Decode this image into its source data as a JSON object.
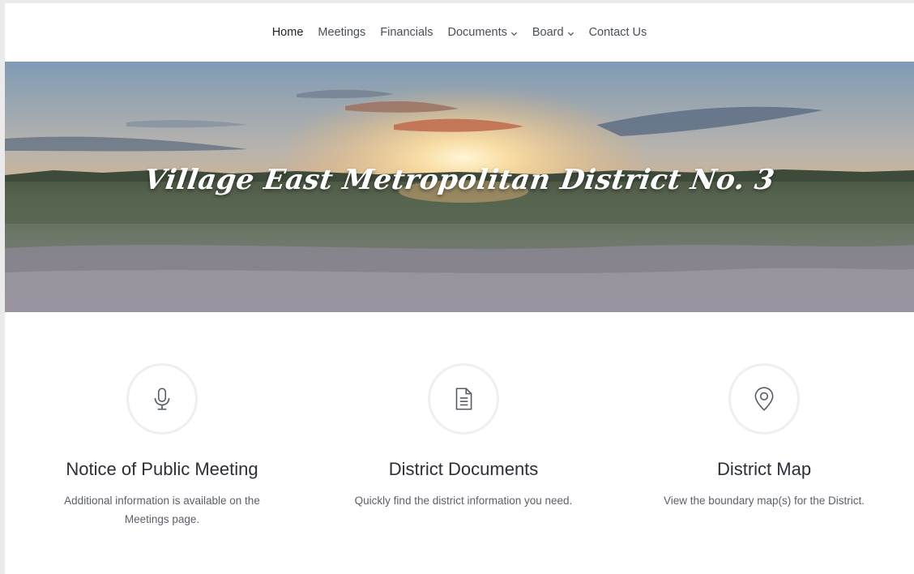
{
  "nav": {
    "items": [
      {
        "label": "Home",
        "active": true,
        "dropdown": false
      },
      {
        "label": "Meetings",
        "active": false,
        "dropdown": false
      },
      {
        "label": "Financials",
        "active": false,
        "dropdown": false
      },
      {
        "label": "Documents",
        "active": false,
        "dropdown": true
      },
      {
        "label": "Board",
        "active": false,
        "dropdown": true
      },
      {
        "label": "Contact Us",
        "active": false,
        "dropdown": false
      }
    ]
  },
  "hero": {
    "title": "Village East Metropolitan District No. 3"
  },
  "features": [
    {
      "icon": "microphone-icon",
      "title": "Notice of Public Meeting",
      "text": "Additional information is available on the Meetings page."
    },
    {
      "icon": "document-icon",
      "title": "District Documents",
      "text": "Quickly find the district information you need."
    },
    {
      "icon": "map-pin-icon",
      "title": "District Map",
      "text": "View the boundary map(s) for the District."
    }
  ],
  "colors": {
    "text_dark": "#2b2f36",
    "text_muted": "#5b6068",
    "icon_stroke": "#555b63"
  }
}
